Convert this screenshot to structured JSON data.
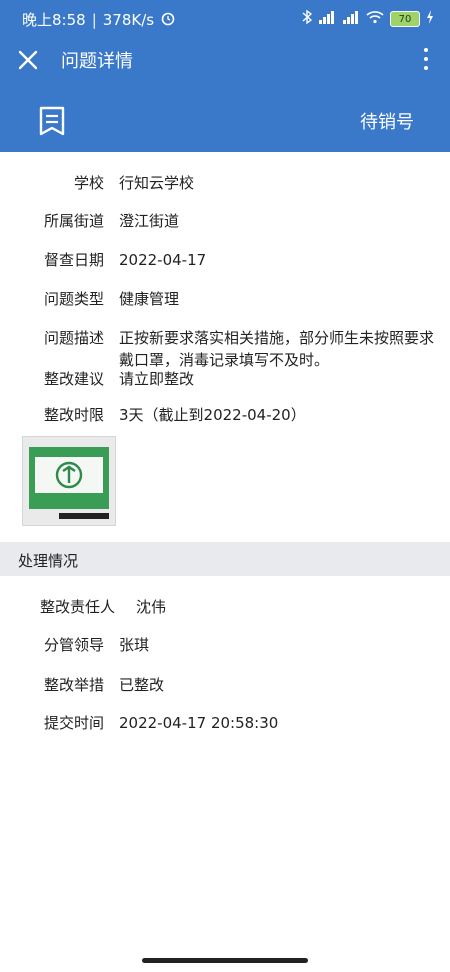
{
  "status_bar": {
    "time": "晚上8:58",
    "speed": "378K/s",
    "battery": "70"
  },
  "app_bar": {
    "title": "问题详情",
    "close_icon": "close-icon",
    "more_icon": "more-vertical-icon"
  },
  "sub_bar": {
    "bookmark_icon": "bookmark-list-icon",
    "status": "待销号"
  },
  "details": [
    {
      "label": "学校",
      "value": "行知云学校"
    },
    {
      "label": "所属街道",
      "value": "澄江街道"
    },
    {
      "label": "督查日期",
      "value": "2022-04-17"
    },
    {
      "label": "问题类型",
      "value": "健康管理"
    },
    {
      "label": "问题描述",
      "value": "正按新要求落实相关措施，部分师生未按照要求戴口罩，消毒记录填写不及时。"
    },
    {
      "label": "整改建议",
      "value": "请立即整改"
    },
    {
      "label": "整改时限",
      "value": "3天（截止到2022-04-20）"
    }
  ],
  "processing": {
    "section_title": "处理情况",
    "items": [
      {
        "label": "整改责任人",
        "value": "沈伟"
      },
      {
        "label": "分管领导",
        "value": "张琪"
      },
      {
        "label": "整改举措",
        "value": "已整改"
      },
      {
        "label": "提交时间",
        "value": "2022-04-17 20:58:30"
      }
    ]
  },
  "colors": {
    "primary": "#3a78c9",
    "section_bg": "#e9eaee"
  }
}
